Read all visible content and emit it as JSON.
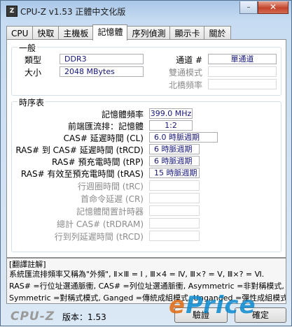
{
  "window": {
    "title": "CPU-Z v1.53 正體中文化版",
    "icon_text": "Z"
  },
  "tabs": [
    "CPU",
    "快取",
    "主機板",
    "記憶體",
    "序列偵測",
    "顯示卡",
    "關於"
  ],
  "active_tab": "記憶體",
  "general": {
    "legend": "一般",
    "type_label": "類型",
    "type_value": "DDR3",
    "size_label": "大小",
    "size_value": "2048 MBytes",
    "channel_label": "通道 #",
    "channel_value": "單通道",
    "dc_mode_label": "雙通模式",
    "dc_mode_value": "",
    "nb_freq_label": "北橋頻率",
    "nb_freq_value": ""
  },
  "timings": {
    "legend": "時序表",
    "rows": [
      {
        "label": "記憶體頻率",
        "value": "399.0 MHz",
        "dim": false
      },
      {
        "label": "前端匯流排：記憶體",
        "value": "1:2",
        "dim": false
      },
      {
        "label": "CAS# 延遲時間 (CL)",
        "value": "6.0 時脈週期",
        "dim": false
      },
      {
        "label": "RAS# 到 CAS# 延遲時間 (tRCD)",
        "value": "6 時脈週期",
        "dim": false
      },
      {
        "label": "RAS# 預充電時間 (tRP)",
        "value": "6 時脈週期",
        "dim": false
      },
      {
        "label": "RAS# 有效至預充電時間 (tRAS)",
        "value": "15 時脈週期",
        "dim": false
      },
      {
        "label": "行週圈時間 (tRC)",
        "value": "",
        "dim": true
      },
      {
        "label": "首命令延遲 (CR)",
        "value": "",
        "dim": true
      },
      {
        "label": "記憶體閒置計時器",
        "value": "",
        "dim": true
      },
      {
        "label": "總計 CAS# (tRDRAM)",
        "value": "",
        "dim": true
      },
      {
        "label": "行到列延遲時間 (tRCD)",
        "value": "",
        "dim": true
      }
    ]
  },
  "notes": {
    "title": "[翻譯註解]",
    "lines": [
      "系統匯流排頻率又稱為\"外頻\", Ⅱ×Ⅲ = Ⅰ , Ⅲ×4 = Ⅳ, Ⅲ×? = Ⅴ, Ⅲ×? = Ⅵ.",
      "RAS# =行位址選通脈衝, CAS# =列位址選通脈衝, Asymmetric =非對稱模式,",
      "Symmetric =對稱式模式, Ganged =傳統成組模式, Unganged =彈性成組模式."
    ]
  },
  "footer": {
    "brand": "CPU-Z",
    "version": "版本：1.53",
    "validate_label": "驗證",
    "ok_label": "確定"
  },
  "watermark": {
    "e": "e",
    "rest": "Price"
  }
}
